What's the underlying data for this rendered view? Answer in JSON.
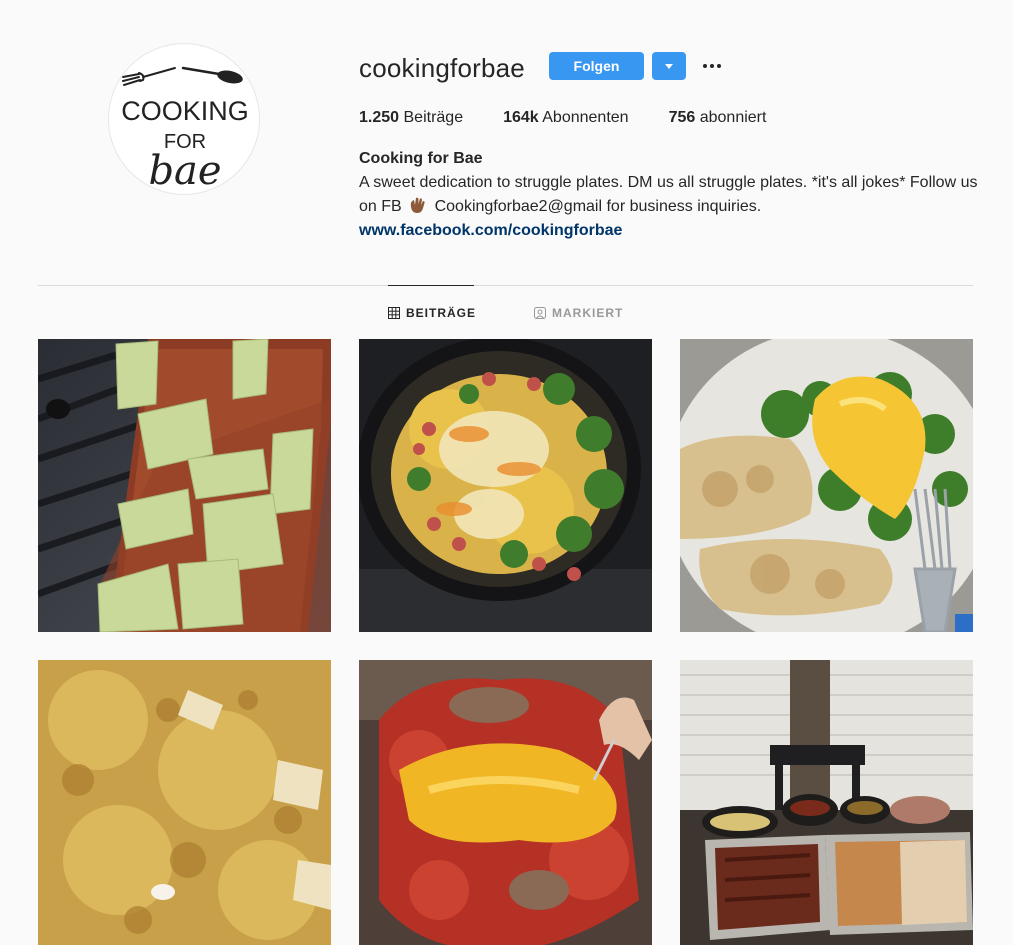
{
  "profile": {
    "username": "cookingforbae",
    "follow_label": "Folgen",
    "avatar": {
      "logo_line1": "COOKING",
      "logo_line2": "FOR",
      "logo_line3": "bae"
    },
    "stats": {
      "posts_count": "1.250",
      "posts_label": "Beiträge",
      "followers_count": "164k",
      "followers_label": "Abonnenten",
      "following_count": "756",
      "following_label": "abonniert"
    },
    "full_name": "Cooking for Bae",
    "bio_part1": "A sweet dedication to struggle plates. DM us all struggle plates. *it's all jokes* Follow us on FB",
    "bio_part2": "Cookingforbae2@gmail for business inquiries.",
    "link": "www.facebook.com/cookingforbae"
  },
  "tabs": [
    {
      "label": "BEITRÄGE",
      "icon": "grid-icon",
      "active": true
    },
    {
      "label": "MARKIERT",
      "icon": "tagged-icon",
      "active": false
    }
  ],
  "posts": [
    {
      "name": "post-pizza-cheese-slices",
      "subject": "pizza with cheese slices on grill"
    },
    {
      "name": "post-skillet-hotdog-broccoli",
      "subject": "skillet with hot dogs, corn, broccoli and cheese"
    },
    {
      "name": "post-chicken-broccoli-cheese",
      "subject": "breaded chicken with broccoli and cheese sauce"
    },
    {
      "name": "post-baked-pasta",
      "subject": "baked bowtie pasta with cheese"
    },
    {
      "name": "post-cheese-filled-turkey",
      "subject": "red roasted meat with cheese sauce"
    },
    {
      "name": "post-table-spread",
      "subject": "table with trays of food and dips"
    }
  ],
  "colors": {
    "accent": "#3897f0",
    "link": "#003569",
    "background": "#fafafa",
    "divider": "#dbdbdb",
    "text": "#262626",
    "muted": "#999999"
  }
}
